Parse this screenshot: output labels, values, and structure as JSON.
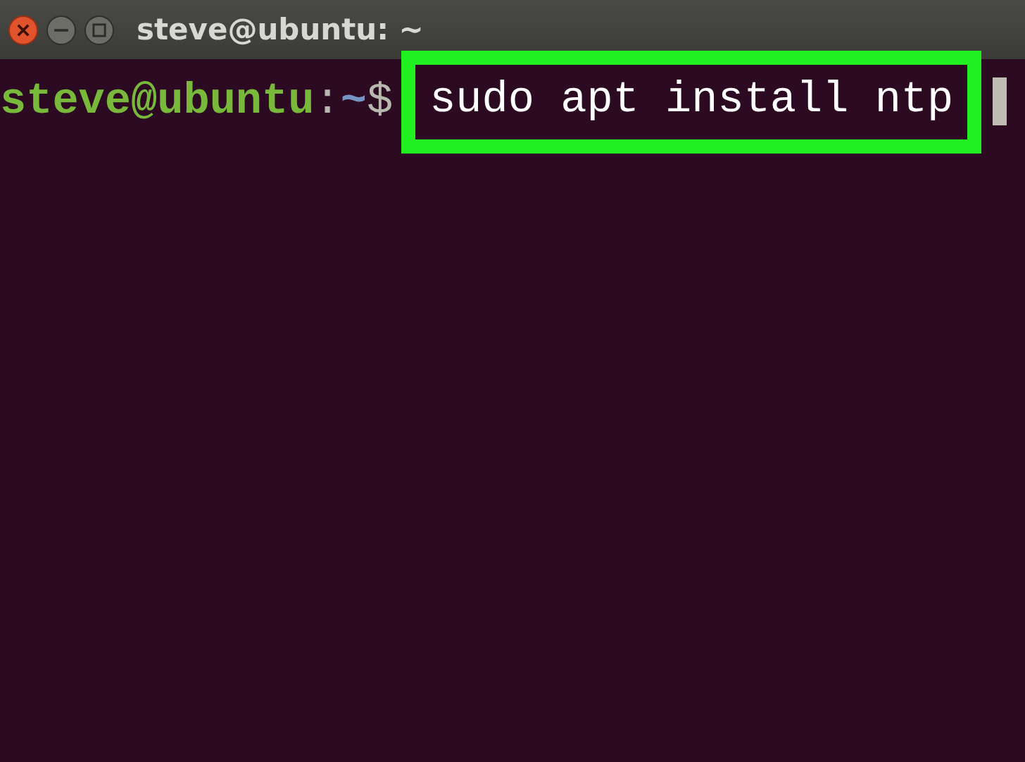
{
  "window": {
    "title": "steve@ubuntu: ~"
  },
  "terminal": {
    "prompt": {
      "user_host": "steve@ubuntu",
      "separator": ":",
      "path": "~",
      "symbol": "$"
    },
    "command": "sudo apt install ntp",
    "highlighted": true
  }
}
